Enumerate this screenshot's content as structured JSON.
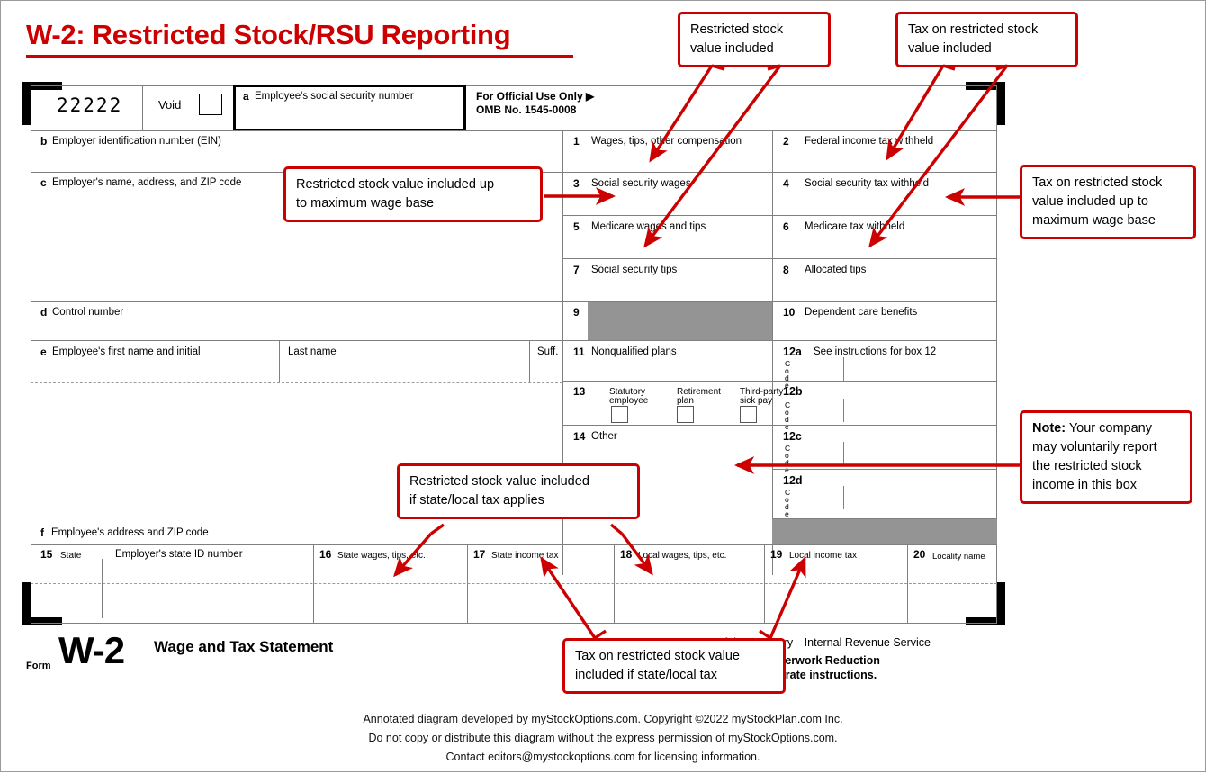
{
  "title": "W-2: Restricted Stock/RSU Reporting",
  "form": {
    "control_digits": "22222",
    "void_label": "Void",
    "box_a": "Employee's social security number",
    "box_a_letter": "a",
    "official_use": "For Official Use Only ▶",
    "omb": "OMB No. 1545-0008",
    "box_b_letter": "b",
    "box_b": "Employer identification number (EIN)",
    "box_c_letter": "c",
    "box_c": "Employer's name, address, and ZIP code",
    "box_d_letter": "d",
    "box_d": "Control number",
    "box_e_letter": "e",
    "box_e": "Employee's first name and initial",
    "box_e_last": "Last name",
    "box_e_suff": "Suff.",
    "box_f_letter": "f",
    "box_f": "Employee's address and ZIP code",
    "numbered": [
      {
        "num": "1",
        "label": "Wages, tips, other compensation"
      },
      {
        "num": "2",
        "label": "Federal income tax withheld"
      },
      {
        "num": "3",
        "label": "Social security wages"
      },
      {
        "num": "4",
        "label": "Social security tax withheld"
      },
      {
        "num": "5",
        "label": "Medicare wages and tips"
      },
      {
        "num": "6",
        "label": "Medicare tax withheld"
      },
      {
        "num": "7",
        "label": "Social security tips"
      },
      {
        "num": "8",
        "label": "Allocated tips"
      },
      {
        "num": "9",
        "label": ""
      },
      {
        "num": "10",
        "label": "Dependent care benefits"
      },
      {
        "num": "11",
        "label": "Nonqualified plans"
      },
      {
        "num": "13",
        "label": ""
      },
      {
        "num": "14",
        "label": "Other"
      }
    ],
    "box12": [
      {
        "num": "12a",
        "label": "See instructions for box 12",
        "code": "Code"
      },
      {
        "num": "12b",
        "label": "",
        "code": "Code"
      },
      {
        "num": "12c",
        "label": "",
        "code": "Code"
      },
      {
        "num": "12d",
        "label": "",
        "code": "Code"
      }
    ],
    "box13": {
      "num": "13",
      "checks": [
        {
          "l1": "Statutory",
          "l2": "employee"
        },
        {
          "l1": "Retirement",
          "l2": "plan"
        },
        {
          "l1": "Third-party",
          "l2": "sick pay"
        }
      ]
    },
    "state_row": [
      {
        "num": "15",
        "label": "State"
      },
      {
        "num": "",
        "label": "Employer's state ID number"
      },
      {
        "num": "16",
        "label": "State wages, tips, etc."
      },
      {
        "num": "17",
        "label": "State income tax"
      },
      {
        "num": "18",
        "label": "Local wages, tips, etc."
      },
      {
        "num": "19",
        "label": "Local income tax"
      },
      {
        "num": "20",
        "label": "Locality name"
      }
    ],
    "footer": {
      "form_word": "Form",
      "form_name": "W-2",
      "form_title": "Wage and Tax Statement",
      "dept_line": "Department of the Treasury—Internal Revenue Service",
      "privacy_line1": "For Privacy Act and Paperwork Reduction",
      "privacy_line2": "Act Notice, see the separate instructions."
    }
  },
  "callouts": [
    {
      "id": "c1",
      "lines": [
        "Restricted stock",
        "value included"
      ]
    },
    {
      "id": "c2",
      "lines": [
        "Tax on restricted stock",
        "value included"
      ]
    },
    {
      "id": "c3",
      "lines": [
        "Restricted stock value included up",
        "to maximum wage base"
      ]
    },
    {
      "id": "c4",
      "lines": [
        "Tax on restricted stock",
        "value included up to",
        "maximum wage base"
      ]
    },
    {
      "id": "c5",
      "bold_prefix": "Note:",
      "lines": [
        " Your company",
        "may voluntarily report",
        "the restricted stock",
        "income in this box"
      ]
    },
    {
      "id": "c6",
      "lines": [
        "Restricted stock value included",
        "if state/local tax applies"
      ]
    },
    {
      "id": "c7",
      "lines": [
        "Tax on restricted stock value",
        "included if state/local tax"
      ]
    }
  ],
  "credit": {
    "line1": "Annotated diagram developed by myStockOptions.com. Copyright ©2022 myStockPlan.com Inc.",
    "line2": "Do not copy or distribute this diagram without the express permission of myStockOptions.com.",
    "line3": "Contact editors@mystockoptions.com for licensing information."
  },
  "colors": {
    "accent": "#cc0000",
    "rule": "#808080",
    "gray_fill": "#949494"
  }
}
